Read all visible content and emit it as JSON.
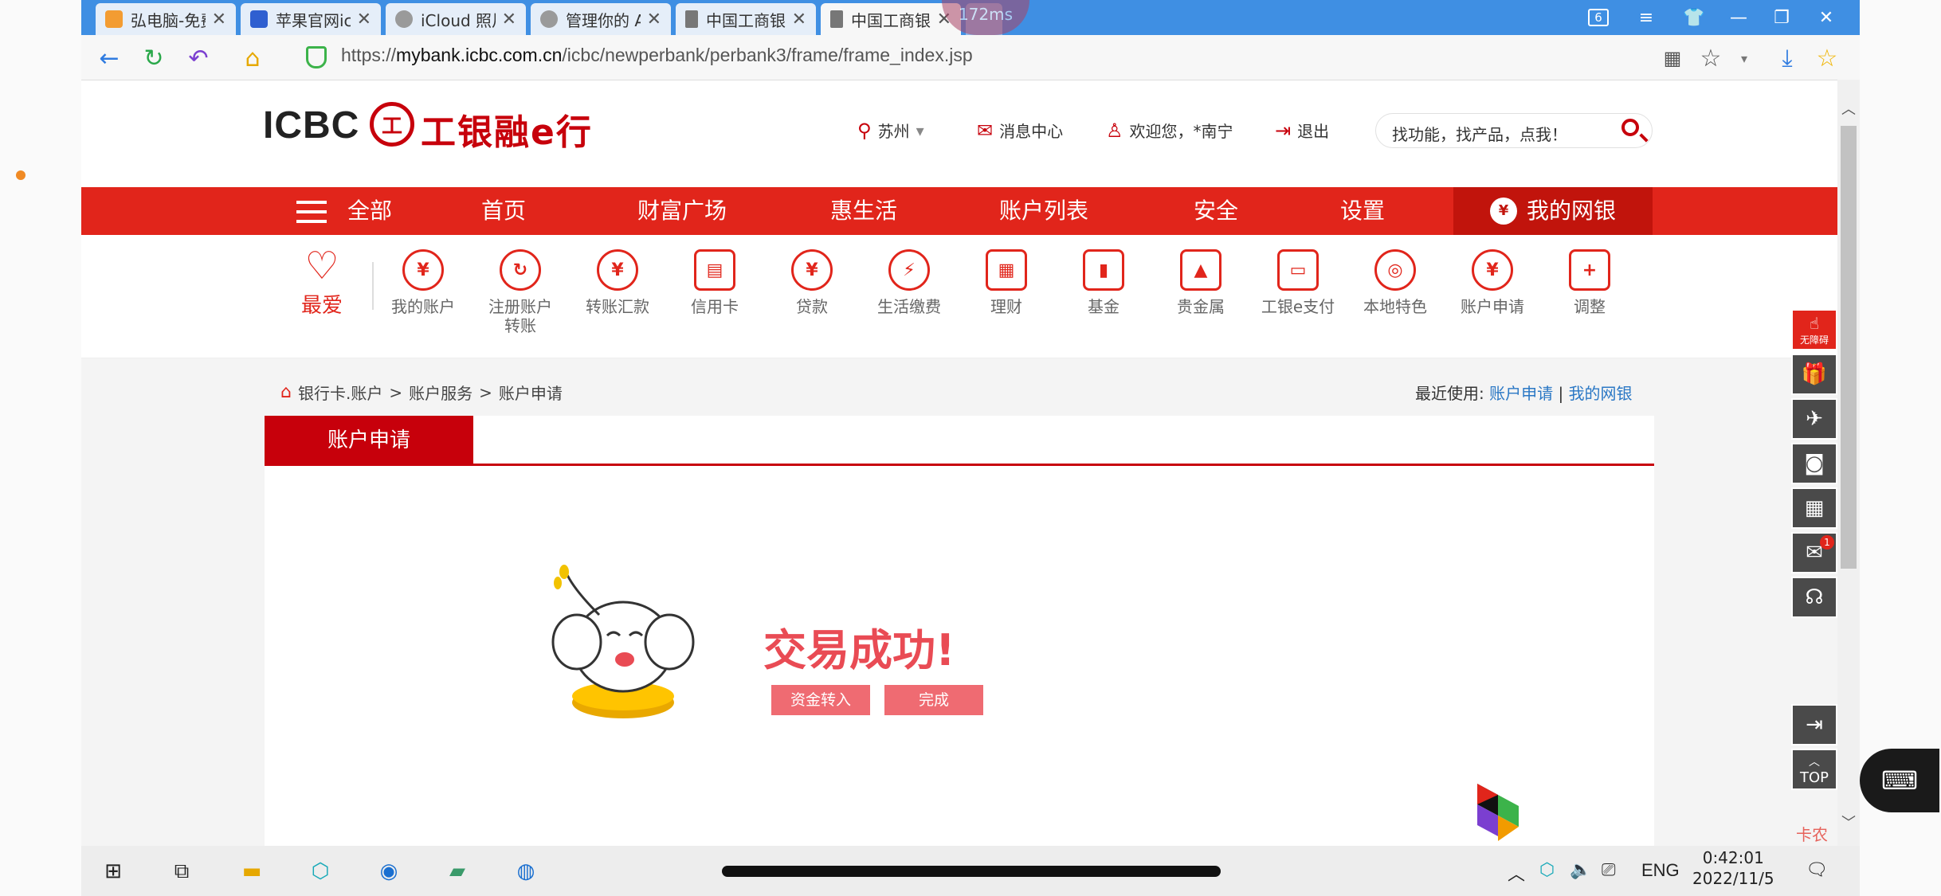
{
  "browser": {
    "tabs": [
      {
        "title": "弘电脑-免费云电脑]",
        "color": "#f39c32"
      },
      {
        "title": "苹果官网icloud登录",
        "color": "#2f5fd0"
      },
      {
        "title": "iCloud 照片",
        "color": "#9a9a9a"
      },
      {
        "title": "管理你的 Apple ID",
        "color": "#9a9a9a"
      },
      {
        "title": "中国工商银行中国网",
        "color": "#777777"
      },
      {
        "title": "中国工商银行新一代",
        "color": "#777777"
      }
    ],
    "ping": "172ms",
    "tab_count": "6",
    "url_prefix": "https://",
    "url_host": "mybank.icbc.com.cn",
    "url_path": "/icbc/newperbank/perbank3/frame/frame_index.jsp"
  },
  "header": {
    "logo_text": "ICBC",
    "logo_mark": "工",
    "logo_cn": "工银融e行",
    "city": "苏州",
    "messages": "消息中心",
    "welcome": "欢迎您，*南宁",
    "logout": "退出",
    "search_placeholder": "找功能，找产品，点我！"
  },
  "nav": {
    "all": "全部",
    "items": [
      "首页",
      "财富广场",
      "惠生活",
      "账户列表",
      "安全",
      "设置"
    ],
    "mybank": "我的网银",
    "mybank_icon": "¥"
  },
  "quick": {
    "fav": "最爱",
    "items": [
      {
        "label": "我的账户",
        "icon": "¥"
      },
      {
        "label": "注册账户\n转账",
        "icon": "↻"
      },
      {
        "label": "转账汇款",
        "icon": "¥"
      },
      {
        "label": "信用卡",
        "icon": "▤"
      },
      {
        "label": "贷款",
        "icon": "¥"
      },
      {
        "label": "生活缴费",
        "icon": "⚡"
      },
      {
        "label": "理财",
        "icon": "▦"
      },
      {
        "label": "基金",
        "icon": "▮"
      },
      {
        "label": "贵金属",
        "icon": "▲"
      },
      {
        "label": "工银e支付",
        "icon": "▭"
      },
      {
        "label": "本地特色",
        "icon": "◎"
      },
      {
        "label": "账户申请",
        "icon": "¥"
      },
      {
        "label": "调整",
        "icon": "+"
      }
    ]
  },
  "breadcrumb": [
    "银行卡.账户",
    "账户服务",
    "账户申请"
  ],
  "recent": {
    "label": "最近使用:",
    "links": [
      "账户申请",
      "我的网银"
    ]
  },
  "panel": {
    "tab": "账户申请",
    "success": "交易成功!",
    "btn_transfer": "资金转入",
    "btn_done": "完成"
  },
  "tools": {
    "red_label": "无障碍",
    "mail_badge": "1",
    "top_label": "TOP"
  },
  "taskbar": {
    "lang": "ENG",
    "time": "0:42:01",
    "date": "2022/11/5"
  },
  "watermark": "卡农"
}
